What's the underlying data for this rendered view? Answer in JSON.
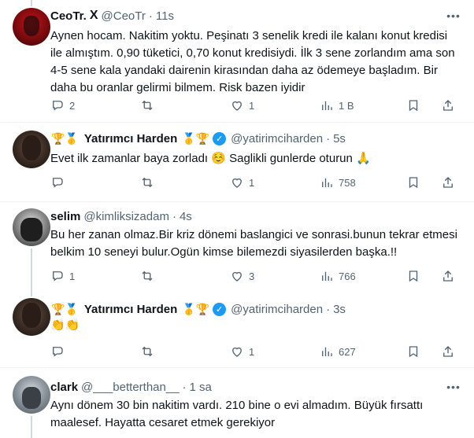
{
  "tweets": [
    {
      "name": "CeoTr.",
      "badge": "X",
      "handle": "@CeoTr",
      "time": "11s",
      "text": "Aynen hocam. Nakitim yoktu. Peşinatı 3 senelik kredi ile kalanı konut kredisi ile almıştım. 0,90 tüketici, 0,70 konut kredisiydi. İlk 3 sene zorlandım ama son 4-5 sene kala yandaki dairenin kirasından daha az ödemeye başladım. Bir daha bu oranlar gelirmi bilmem. Risk bazen iyidir",
      "replies": "2",
      "retweets": "",
      "likes": "1",
      "views": "1 B"
    },
    {
      "name": "Yatırımcı Harden",
      "name_prefix_emoji": "🏆🥇",
      "name_suffix_emoji": "🥇🏆",
      "handle": "@yatirimciharden",
      "time": "5s",
      "text": "Evet ilk zamanlar baya zorladı ☺️ Saglikli gunlerde oturun 🙏",
      "replies": "",
      "retweets": "",
      "likes": "1",
      "views": "758"
    },
    {
      "name": "selim",
      "handle": "@kimliksizadam",
      "time": "4s",
      "text": "Bu her zanan olmaz.Bir kriz dönemi baslangici ve sonrasi.bunun tekrar etmesi belkim 10 seneyi bulur.Ogün kimse bilemezdi siyasilerden başka.!!",
      "replies": "1",
      "retweets": "",
      "likes": "3",
      "views": "766"
    },
    {
      "name": "Yatırımcı Harden",
      "name_prefix_emoji": "🏆🥇",
      "name_suffix_emoji": "🥇🏆",
      "handle": "@yatirimciharden",
      "time": "3s",
      "text": "👏👏",
      "replies": "",
      "retweets": "",
      "likes": "1",
      "views": "627"
    },
    {
      "name": "clark",
      "handle": "@___betterthan__",
      "time": "1 sa",
      "text": "Aynı dönem 30 bin nakitim vardı. 210 bine o evi almadım. Büyük fırsattı maalesef. Hayatta cesaret etmek gerekiyor"
    }
  ],
  "colors": {
    "text": "#0f1419",
    "secondary": "#536471",
    "verified": "#1d9bf0",
    "separator": "#eff3f4",
    "thread_line": "#cfd9de"
  },
  "icons": [
    "reply-icon",
    "retweet-icon",
    "like-icon",
    "views-icon",
    "bookmark-icon",
    "share-icon",
    "more-icon",
    "verified-icon"
  ]
}
